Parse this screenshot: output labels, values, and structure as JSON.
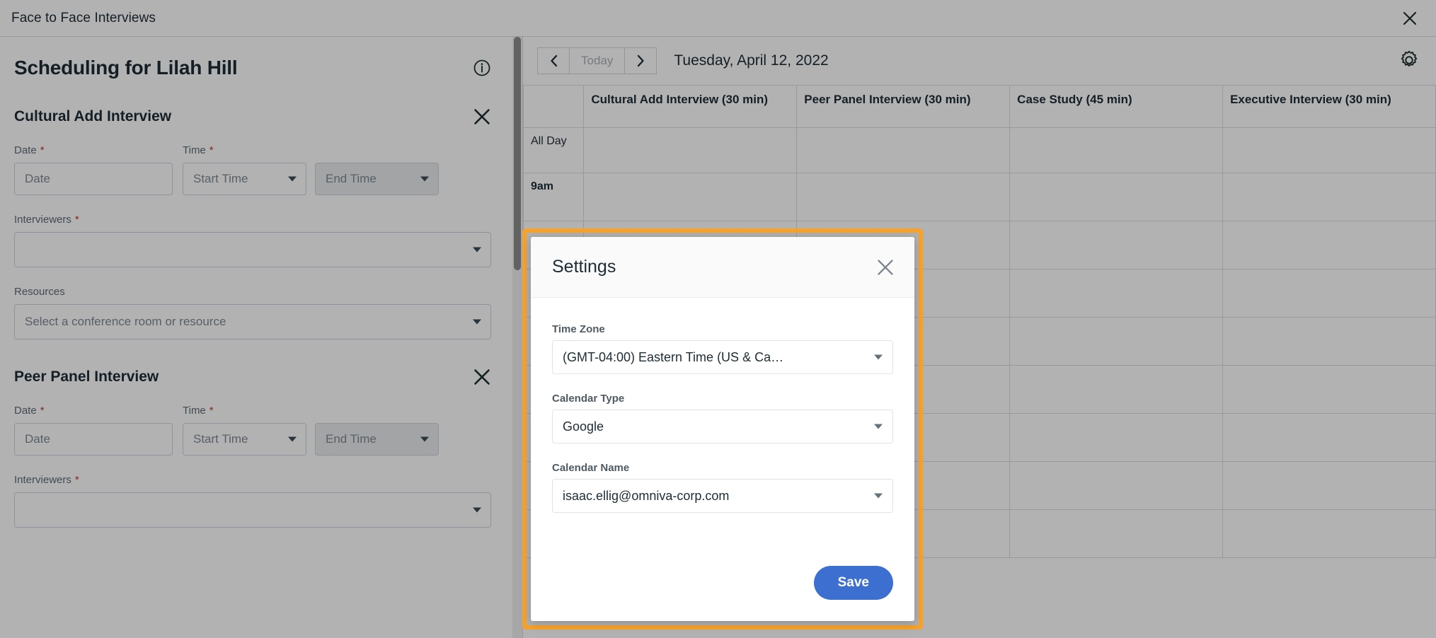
{
  "window": {
    "title": "Face to Face Interviews",
    "close_icon": "close-icon"
  },
  "left_panel": {
    "page_title": "Scheduling for Lilah Hill",
    "info_icon": "info-circle-icon",
    "sections": [
      {
        "title": "Cultural Add Interview",
        "close_icon": "close-icon",
        "date_label": "Date",
        "date_required": "*",
        "date_placeholder": "Date",
        "time_label": "Time",
        "time_required": "*",
        "start_time_placeholder": "Start Time",
        "end_time_placeholder": "End Time",
        "interviewers_label": "Interviewers",
        "interviewers_required": "*",
        "interviewers_value": "",
        "resources_label": "Resources",
        "resources_placeholder": "Select a conference room or resource"
      },
      {
        "title": "Peer Panel Interview",
        "close_icon": "close-icon",
        "date_label": "Date",
        "date_required": "*",
        "date_placeholder": "Date",
        "time_label": "Time",
        "time_required": "*",
        "start_time_placeholder": "Start Time",
        "end_time_placeholder": "End Time",
        "interviewers_label": "Interviewers",
        "interviewers_required": "*",
        "interviewers_value": ""
      }
    ]
  },
  "calendar": {
    "prev_label": "‹",
    "next_label": "›",
    "today_label": "Today",
    "current_date": "Tuesday, April 12, 2022",
    "settings_icon": "gear-icon",
    "time_col_header": "",
    "columns": [
      "Cultural Add Interview (30 min)",
      "Peer Panel Interview (30 min)",
      "Case Study (45 min)",
      "Executive Interview (30 min)"
    ],
    "rows": [
      {
        "label": "All Day"
      },
      {
        "label": "9am"
      },
      {
        "label": ""
      },
      {
        "label": ""
      },
      {
        "label": ""
      },
      {
        "label": ""
      },
      {
        "label": ""
      },
      {
        "label": ""
      },
      {
        "label": ""
      }
    ]
  },
  "modal": {
    "title": "Settings",
    "close_icon": "close-icon",
    "highlight_color": "#f7a32b",
    "fields": [
      {
        "label": "Time Zone",
        "value": "(GMT-04:00) Eastern Time (US & Ca…"
      },
      {
        "label": "Calendar Type",
        "value": "Google"
      },
      {
        "label": "Calendar Name",
        "value": "isaac.ellig@omniva-corp.com"
      }
    ],
    "save_label": "Save",
    "save_color": "#3c6fd0"
  }
}
